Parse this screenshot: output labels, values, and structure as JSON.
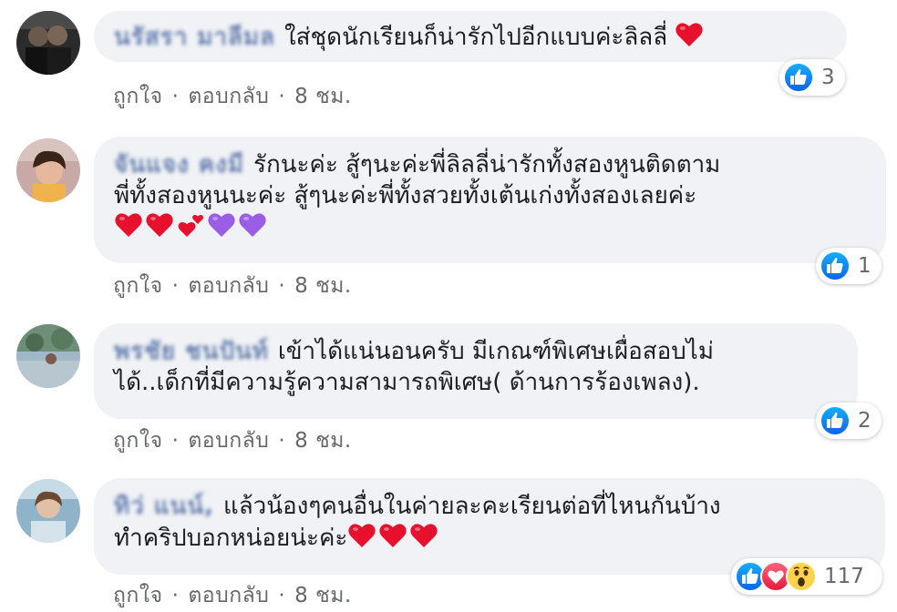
{
  "comments": [
    {
      "name": "นรัสรา มาลีมล",
      "text": "ใส่ชุดนักเรียนก็น่ารักไปอีกแบบค่ะลิลลี่",
      "emojis": [
        "heart"
      ],
      "actions": {
        "like": "ถูกใจ",
        "reply": "ตอบกลับ",
        "time": "8 ชม."
      },
      "reaction_count": "3",
      "reaction_icons": [
        "like"
      ]
    },
    {
      "name": "จันแจง คงมี",
      "text_line1": "รักนะค่ะ สู้ๆนะค่ะพี่ลิลลี่น่ารักทั้งสองหูนติดตาม",
      "text_line2": "พี่ทั้งสองหูนนะค่ะ สู้ๆนะค่ะพี่ทั้งสวยทั้งเต้นเก่งทั้งสองเลยค่ะ",
      "emojis": [
        "heart",
        "heart",
        "two-hearts",
        "purple-heart",
        "purple-heart"
      ],
      "actions": {
        "like": "ถูกใจ",
        "reply": "ตอบกลับ",
        "time": "8 ชม."
      },
      "reaction_count": "1",
      "reaction_icons": [
        "like"
      ]
    },
    {
      "name": "พรชัย ชนปันท์",
      "text_line1": "เข้าได้แน่นอนครับ มีเกณฑ์พิเศษเผื่อสอบไม่",
      "text_line2": "ได้..เด็กที่มีความรู้ความสามารถพิเศษ( ด้านการร้องเพลง).",
      "actions": {
        "like": "ถูกใจ",
        "reply": "ตอบกลับ",
        "time": "8 ชม."
      },
      "reaction_count": "2",
      "reaction_icons": [
        "like"
      ]
    },
    {
      "name": "ทิว่ แนน์,",
      "text_line1": "แล้วน้องๆคนอื่นในค่ายละคะเรียนต่อที่ไหนกันบ้าง",
      "text_line2": "ทำคริปบอกหน่อยน่ะค่ะ",
      "emojis": [
        "heart",
        "heart",
        "heart"
      ],
      "actions": {
        "like": "ถูกใจ",
        "reply": "ตอบกลับ",
        "time": "8 ชม."
      },
      "reaction_count": "117",
      "reaction_icons": [
        "like",
        "love",
        "wow"
      ]
    }
  ],
  "colors": {
    "bubble": "#f0f2f5",
    "name": "#385898",
    "meta": "#65676b",
    "like_blue": "#1877f2",
    "love_red": "#f33e58",
    "heart_red": "#e8112d",
    "purple_heart": "#9b5de5"
  }
}
